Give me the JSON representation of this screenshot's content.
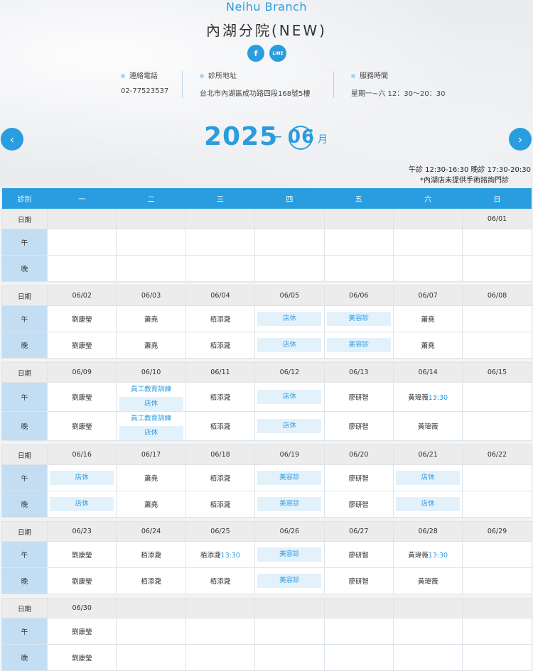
{
  "header": {
    "branch_en": "Neihu Branch",
    "branch_zh": "內湖分院(NEW)",
    "social": [
      "f",
      "LINE"
    ],
    "info": [
      {
        "label": "連絡電話",
        "value": "02-77523537"
      },
      {
        "label": "診所地址",
        "value": "台北市內湖區成功路四段168號5樓"
      },
      {
        "label": "服務時間",
        "value": "星期一~六 12：30～20：30"
      }
    ]
  },
  "calendar": {
    "year": "2025",
    "dash": "–",
    "month": "06",
    "month_suffix": "月",
    "note1": "午診 12:30-16:30  晚診 17:30-20:30",
    "note2": "*內湖店未提供手術諮詢門診"
  },
  "table": {
    "headers": [
      "診別",
      "一",
      "二",
      "三",
      "四",
      "五",
      "六",
      "日"
    ],
    "date_label": "日期",
    "noon": "午",
    "evening": "晚",
    "weeks": [
      {
        "dates": [
          "",
          "",
          "",
          "",
          "",
          "",
          "06/01"
        ],
        "noon": [
          "",
          "",
          "",
          "",
          "",
          "",
          ""
        ],
        "evening": [
          "",
          "",
          "",
          "",
          "",
          "",
          ""
        ]
      },
      {
        "dates": [
          "06/02",
          "06/03",
          "06/04",
          "06/05",
          "06/06",
          "06/07",
          "06/08"
        ],
        "noon": [
          "劉康瑩",
          "蕭堯",
          "栢添瀧",
          "店休",
          "美容診",
          "蕭堯",
          ""
        ],
        "evening": [
          "劉康瑩",
          "蕭堯",
          "栢添瀧",
          "店休",
          "美容診",
          "蕭堯",
          ""
        ]
      },
      {
        "dates": [
          "06/09",
          "06/10",
          "06/11",
          "06/12",
          "06/13",
          "06/14",
          "06/15"
        ],
        "noon": [
          "劉康瑩",
          "員工教育訓練|店休",
          "栢添瀧",
          "店休",
          "廖研智",
          "黃瑋薇|13:30",
          ""
        ],
        "evening": [
          "劉康瑩",
          "員工教育訓練|店休",
          "栢添瀧",
          "店休",
          "廖研智",
          "黃瑋薇",
          ""
        ]
      },
      {
        "dates": [
          "06/16",
          "06/17",
          "06/18",
          "06/19",
          "06/20",
          "06/21",
          "06/22"
        ],
        "noon": [
          "店休",
          "蕭堯",
          "栢添瀧",
          "美容診",
          "廖研智",
          "店休",
          ""
        ],
        "evening": [
          "店休",
          "蕭堯",
          "栢添瀧",
          "美容診",
          "廖研智",
          "店休",
          ""
        ]
      },
      {
        "dates": [
          "06/23",
          "06/24",
          "06/25",
          "06/26",
          "06/27",
          "06/28",
          "06/29"
        ],
        "noon": [
          "劉康瑩",
          "栢添瀧",
          "栢添瀧|13:30",
          "美容診",
          "廖研智",
          "黃瑋薇|13:30",
          ""
        ],
        "evening": [
          "劉康瑩",
          "栢添瀧",
          "栢添瀧",
          "美容診",
          "廖研智",
          "黃瑋薇",
          ""
        ]
      },
      {
        "dates": [
          "06/30",
          "",
          "",
          "",
          "",
          "",
          ""
        ],
        "noon": [
          "劉康瑩",
          "",
          "",
          "",
          "",
          "",
          ""
        ],
        "evening": [
          "劉康瑩",
          "",
          "",
          "",
          "",
          "",
          ""
        ]
      }
    ]
  },
  "colors": {
    "accent": "#2a9de0",
    "shift_bg": "#c3ddf3",
    "tag_bg": "#e3f1fb",
    "date_row_bg": "#ececec"
  }
}
